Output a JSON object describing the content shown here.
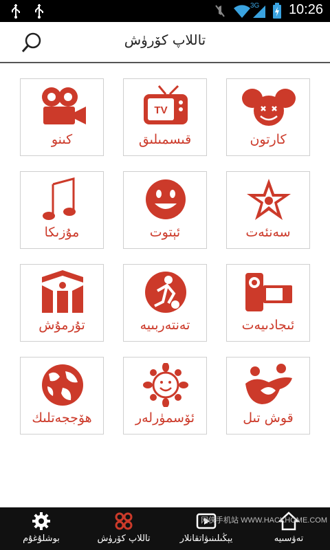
{
  "statusbar": {
    "time": "10:26",
    "network": "3G",
    "icons": [
      "usb-icon",
      "usb-icon",
      "mute-icon",
      "wifi-icon",
      "signal-icon",
      "battery-icon"
    ]
  },
  "header": {
    "title": "تاللاپ كۆرۈش",
    "search_icon": "search-icon"
  },
  "tiles": [
    {
      "label": "كىنو",
      "icon": "movie-camera-icon"
    },
    {
      "label": "قىسمىلىق",
      "icon": "tv-icon"
    },
    {
      "label": "كارتون",
      "icon": "cartoon-mouse-icon"
    },
    {
      "label": "مۇزىكا",
      "icon": "music-note-icon"
    },
    {
      "label": "ئېتوت",
      "icon": "smiley-icon"
    },
    {
      "label": "سەنئەت",
      "icon": "art-star-icon"
    },
    {
      "label": "تۇرمۇش",
      "icon": "life-icon"
    },
    {
      "label": "تەنتەربىيە",
      "icon": "sports-icon"
    },
    {
      "label": "ئىجادىيەت",
      "icon": "video-camera-icon"
    },
    {
      "label": "ھۆججەتلىك",
      "icon": "globe-icon"
    },
    {
      "label": "ئۆسمۈرلەر",
      "icon": "sun-icon"
    },
    {
      "label": "قوش تىل",
      "icon": "family-icon"
    }
  ],
  "tabbar": {
    "tabs": [
      {
        "label": "بوشلۇغۇم",
        "icon": "gear-icon"
      },
      {
        "label": "تاللاپ كۆرۈش",
        "icon": "grid-icon"
      },
      {
        "label": "يېڭىلىنىۋاتقانلار",
        "icon": "play-icon"
      },
      {
        "label": "تەۋسىيە",
        "icon": "home-icon"
      }
    ]
  },
  "watermark": "网侠手机站 WWW.HACKHOME.COM",
  "colors": {
    "accent": "#cc3a2a",
    "statusbar": "#000000",
    "tabbar": "#111111"
  }
}
